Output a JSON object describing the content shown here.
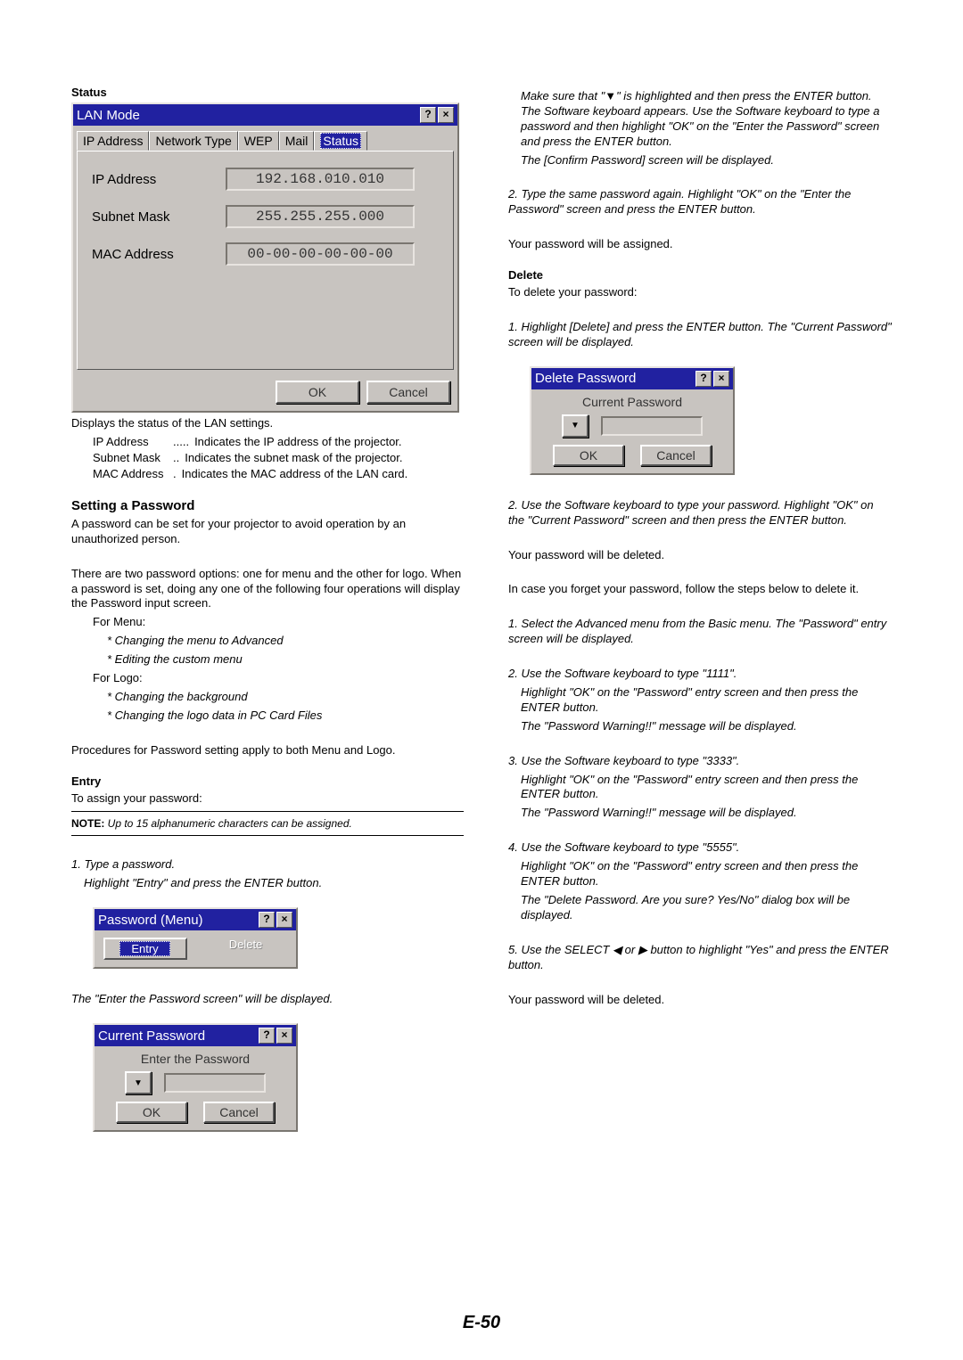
{
  "status_heading": "Status",
  "lan_panel": {
    "title": "LAN Mode",
    "tabs": [
      "IP Address",
      "Network Type",
      "WEP",
      "Mail",
      "Status"
    ],
    "active_tab": "Status",
    "fields": {
      "ip_label": "IP Address",
      "ip_value": "192.168.010.010",
      "subnet_label": "Subnet Mask",
      "subnet_value": "255.255.255.000",
      "mac_label": "MAC Address",
      "mac_value": "00-00-00-00-00-00"
    },
    "ok": "OK",
    "cancel": "Cancel"
  },
  "status_desc": "Displays the status of the LAN settings.",
  "defs": {
    "ip": {
      "term": "IP Address",
      "dots": ".....",
      "desc": "Indicates the IP address of the projector."
    },
    "subnet": {
      "term": "Subnet Mask",
      "dots": "..",
      "desc": "Indicates the subnet mask of the projector."
    },
    "mac": {
      "term": "MAC Address",
      "dots": ".",
      "desc": "Indicates the MAC address of the LAN card."
    }
  },
  "setpw_heading": "Setting a Password",
  "setpw_p1": "A password can be set for your projector to avoid operation by an unauthorized person.",
  "setpw_p2": "There are two password options: one for menu and the other for logo. When a password is set, doing any one of the following four operations will display the Password input screen.",
  "for_menu": "For Menu:",
  "menu_items": [
    "Changing the menu to Advanced",
    "Editing the custom menu"
  ],
  "for_logo": "For Logo:",
  "logo_items": [
    "Changing the background",
    "Changing the logo data in PC Card Files"
  ],
  "proc_line": "Procedures for Password setting apply to both Menu and Logo.",
  "entry_heading": "Entry",
  "entry_line": "To assign your password:",
  "note_label": "NOTE:",
  "note_text": " Up to 15 alphanumeric characters can be assigned.",
  "entry_step1a": "1. Type a password.",
  "entry_step1b": "Highlight \"Entry\" and press the ENTER button.",
  "pwmenu": {
    "title": "Password (Menu)",
    "entry": "Entry",
    "delete": "Delete"
  },
  "entry_caption": "The \"Enter the Password screen\" will be displayed.",
  "curpw": {
    "title": "Current Password",
    "label": "Enter the Password",
    "ok": "OK",
    "cancel": "Cancel"
  },
  "rcol": {
    "p1": "Make sure that \"▼\" is highlighted and then press the ENTER button. The Software keyboard appears. Use the Software keyboard to type a password and then highlight \"OK\" on the \"Enter the Password\" screen and press the ENTER button.",
    "p1b": "The [Confirm Password] screen will be displayed.",
    "p2": "2. Type the same password again. Highlight \"OK\" on the \"Enter the Password\" screen and press the ENTER button.",
    "p3": "Your password will be assigned.",
    "delete_heading": "Delete",
    "delete_line": "To delete your password:",
    "del_step1": "1. Highlight [Delete] and press the ENTER button. The \"Current Password\" screen will be displayed.",
    "delpw": {
      "title": "Delete Password",
      "label": "Current Password",
      "ok": "OK",
      "cancel": "Cancel"
    },
    "del_step2": "2. Use the Software keyboard to type your password. Highlight \"OK\" on the \"Current Password\" screen and then press the ENTER button.",
    "del_p_deleted": "Your password will be deleted.",
    "forgot": "In case you forget your password, follow the steps below to delete it.",
    "f1": "1. Select the Advanced menu from the Basic menu. The \"Password\" entry screen will be displayed.",
    "f2a": "2. Use the Software keyboard to type \"1111\".",
    "f2b": "Highlight \"OK\" on the \"Password\" entry screen and then press the ENTER button.",
    "f2c": "The \"Password Warning!!\" message will be displayed.",
    "f3a": "3. Use the Software keyboard to type \"3333\".",
    "f3b": "Highlight \"OK\" on the \"Password\" entry screen and then press the ENTER button.",
    "f3c": "The \"Password Warning!!\" message will be displayed.",
    "f4a": "4. Use the Software keyboard to type \"5555\".",
    "f4b": "Highlight \"OK\" on the \"Password\" entry screen and then press the ENTER button.",
    "f4c": "The \"Delete Password. Are you sure? Yes/No\" dialog box will be displayed.",
    "f5": "5. Use the SELECT ◀ or ▶ button to highlight \"Yes\" and press the ENTER button.",
    "final": "Your password will be deleted."
  },
  "page_num": "E-50"
}
